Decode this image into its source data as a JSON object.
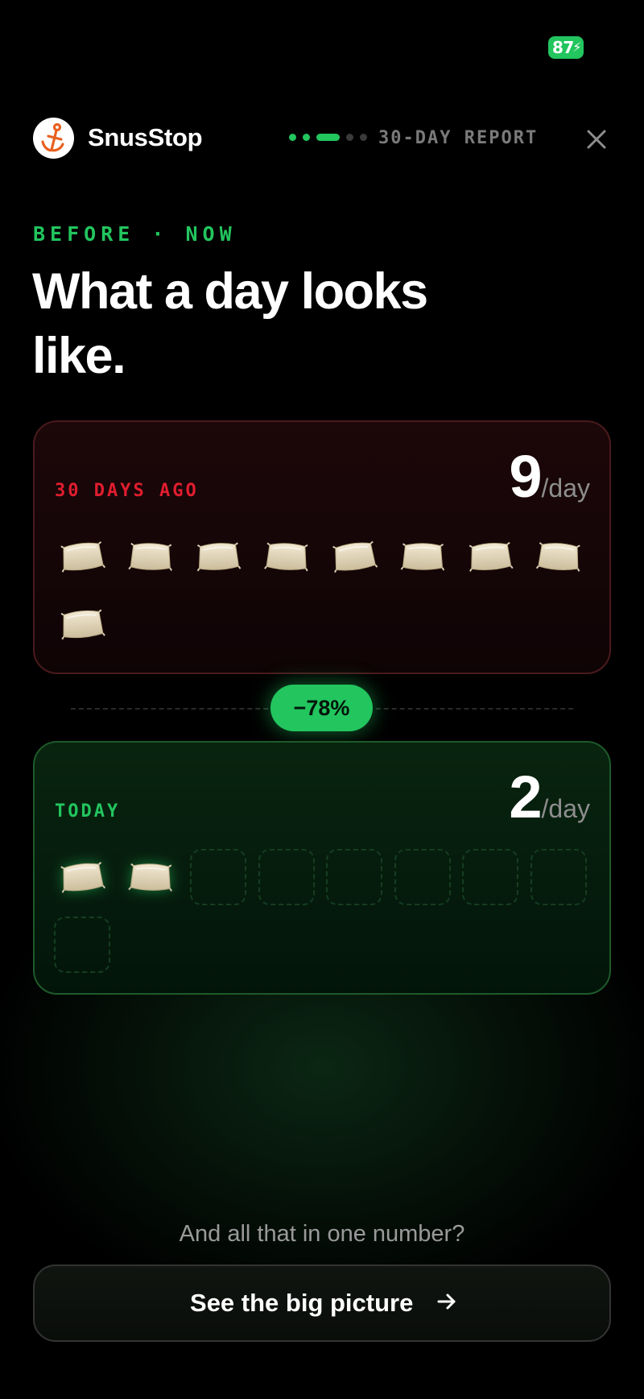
{
  "status_bar": {
    "battery": "87",
    "battery_icon": "charging-bolt-icon",
    "accent": "#22c55e"
  },
  "header": {
    "app_name": "SnusStop",
    "logo_icon": "anchor-icon",
    "report_label": "30-DAY REPORT",
    "close_icon": "close-icon",
    "progress": {
      "total_steps": 5,
      "current_step": 3
    }
  },
  "hero": {
    "eyebrow": "BEFORE · NOW",
    "headline": "What a day looks like."
  },
  "before_card": {
    "label": "30 DAYS AGO",
    "value": "9",
    "unit": "/day",
    "pouches_used": 9,
    "slots": 9,
    "accent": "#e11d2e"
  },
  "change_badge": {
    "value": "−78%"
  },
  "now_card": {
    "label": "TODAY",
    "value": "2",
    "unit": "/day",
    "pouches_used": 2,
    "slots": 9,
    "accent": "#22c55e"
  },
  "footer": {
    "teaser": "And all that in one number?",
    "cta_label": "See the big picture",
    "cta_icon": "arrow-right-icon"
  }
}
